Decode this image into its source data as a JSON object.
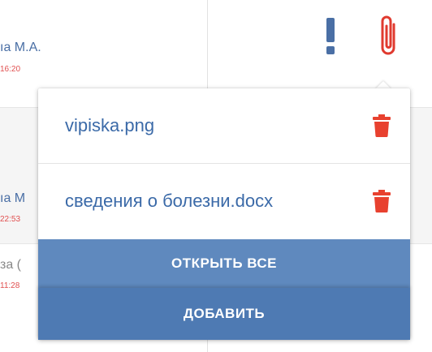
{
  "background_list": {
    "rows": [
      {
        "name": "ıa М.А.",
        "time": "16:20"
      },
      {
        "name": "ıa М",
        "time": "22:53"
      },
      {
        "name": "за (",
        "time": "11:28"
      }
    ]
  },
  "header_icons": {
    "alert": "exclamation-icon",
    "attachment": "paperclip-icon",
    "alert_color": "#4a6fa5",
    "attachment_color": "#e03a2f"
  },
  "attachments_popup": {
    "files": [
      {
        "name": "vipiska.png",
        "delete_icon": "trash-icon"
      },
      {
        "name": "сведения о болезни.docx",
        "delete_icon": "trash-icon"
      }
    ],
    "open_all_label": "ОТКРЫТЬ ВСЕ",
    "add_label": "ДОБАВИТЬ"
  },
  "colors": {
    "link_blue": "#3b6aa8",
    "delete_red": "#e8412f",
    "button_blue": "#5f89be",
    "button_blue_dark": "#4e7ab3",
    "time_red": "#e05050"
  }
}
